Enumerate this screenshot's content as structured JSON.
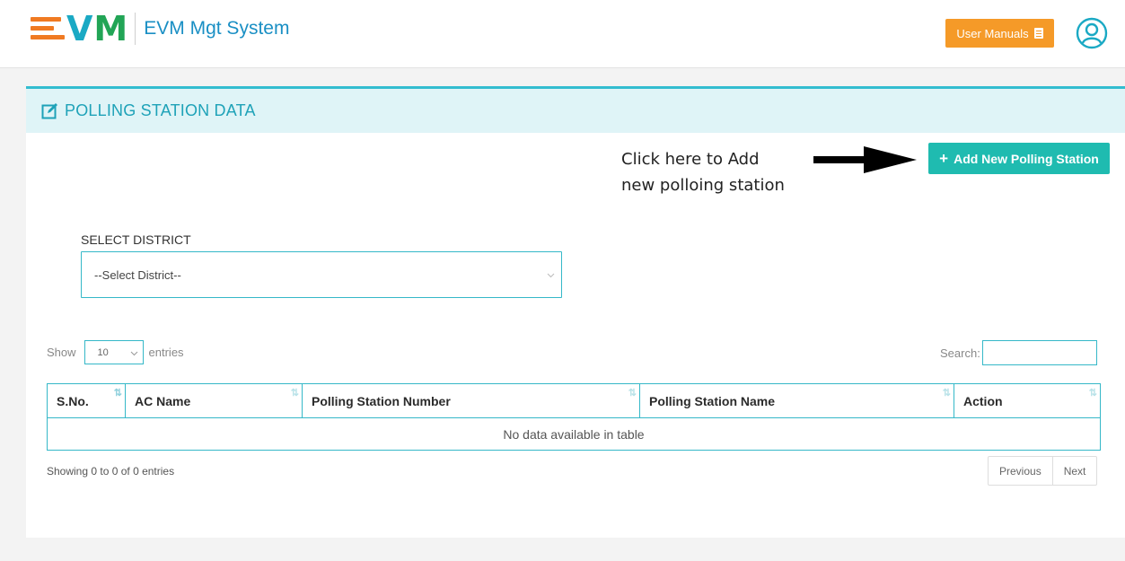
{
  "header": {
    "logo_v": "V",
    "logo_m": "M",
    "app_title": "EVM Mgt System",
    "user_manuals_label": "User Manuals"
  },
  "panel": {
    "title": "POLLING STATION DATA",
    "add_button_label": "Add New Polling Station",
    "annotation_line1": "Click here to Add",
    "annotation_line2": "new polloing station"
  },
  "filter": {
    "district_label": "SELECT DISTRICT",
    "district_selected": "--Select District--"
  },
  "table_controls": {
    "show_label": "Show",
    "entries_value": "10",
    "entries_label": "entries",
    "search_label": "Search:"
  },
  "table": {
    "columns": [
      "S.No.",
      "AC Name",
      "Polling Station Number",
      "Polling Station Name",
      "Action"
    ],
    "empty_message": "No data available in table"
  },
  "footer": {
    "info": "Showing 0 to 0 of 0 entries",
    "previous_label": "Previous",
    "next_label": "Next"
  },
  "colors": {
    "accent": "#33bdd0",
    "add_button": "#1fbbb0",
    "manuals_button": "#f59a28",
    "logo_orange": "#f07a22",
    "logo_blue": "#1aa9c4",
    "logo_green": "#22a556"
  },
  "icons": [
    "user-avatar-icon",
    "document-icon",
    "edit-icon",
    "plus-icon",
    "chevron-down-icon",
    "sort-icon",
    "arrow-right-icon"
  ]
}
